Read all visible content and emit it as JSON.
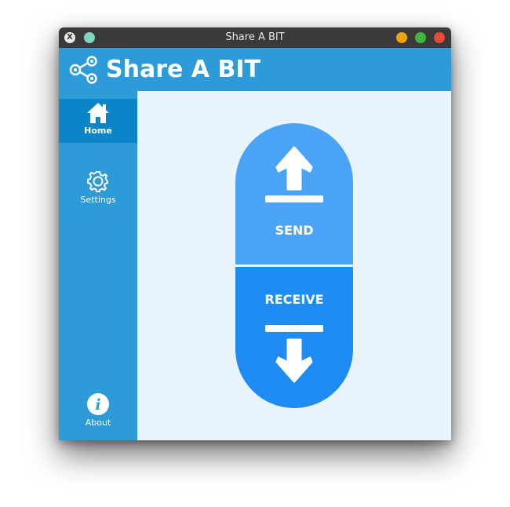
{
  "window": {
    "title": "Share A BIT",
    "controls": {
      "minimize_color": "#f0a30a",
      "maximize_color": "#3cb73c",
      "close_color": "#e84b3c"
    }
  },
  "header": {
    "logo_icon": "share-nodes-icon",
    "title": "Share A BIT",
    "background": "#2c9bd8"
  },
  "sidebar": {
    "items": [
      {
        "label": "Home",
        "icon": "home-icon",
        "active": true
      },
      {
        "label": "Settings",
        "icon": "gear-icon",
        "active": false
      },
      {
        "label": "About",
        "icon": "info-icon",
        "active": false
      }
    ]
  },
  "main": {
    "send": {
      "label": "SEND",
      "icon": "upload-arrow-icon",
      "color": "#4aa3f5"
    },
    "receive": {
      "label": "RECEIVE",
      "icon": "download-arrow-icon",
      "color": "#1e8cf2"
    }
  }
}
